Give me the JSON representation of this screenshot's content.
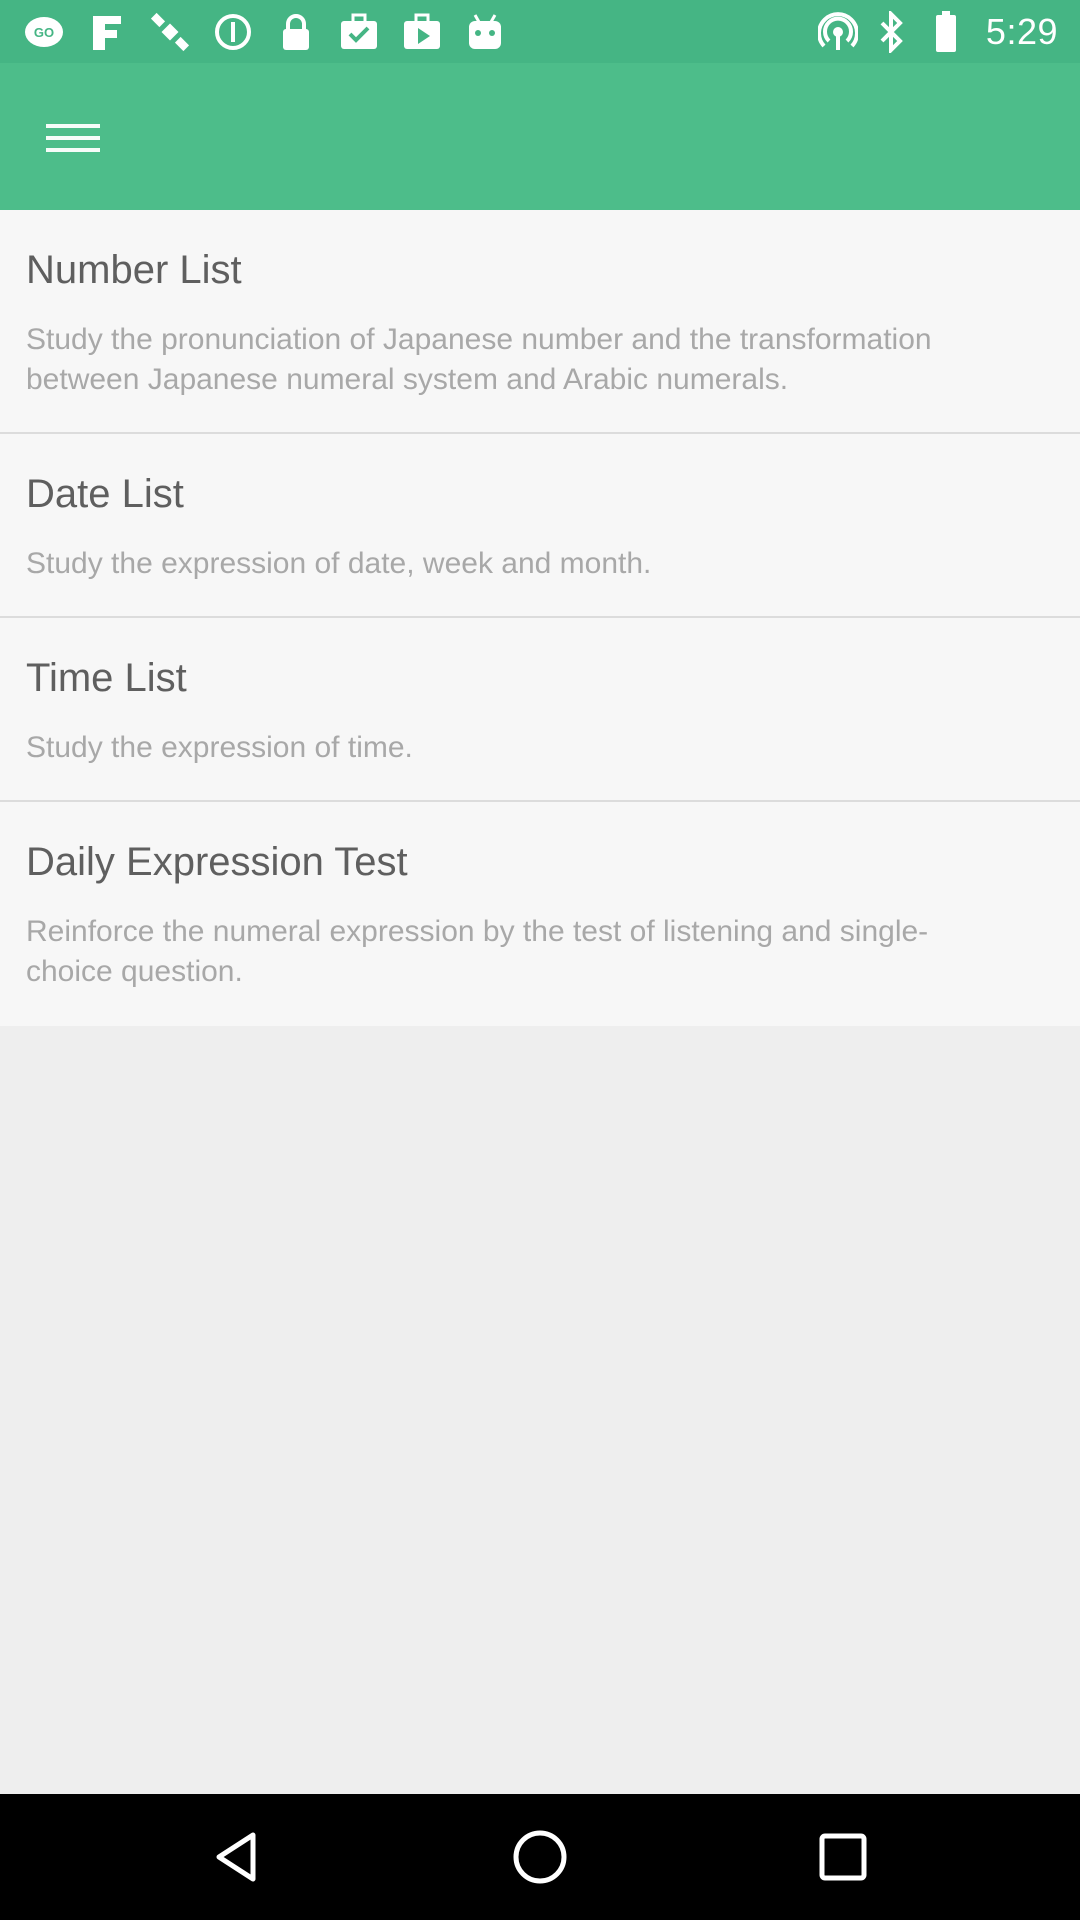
{
  "status_bar": {
    "time": "5:29",
    "left_icons": [
      "go-icon",
      "fake-icon",
      "satellite-icon",
      "alert-icon",
      "lock-icon",
      "briefcase-check-icon",
      "play-store-icon",
      "android-icon"
    ],
    "right_icons": [
      "hotspot-icon",
      "bluetooth-icon",
      "battery-icon"
    ]
  },
  "app_bar": {
    "menu_icon": "hamburger-menu-icon",
    "color": "#4dbd8a"
  },
  "items": [
    {
      "title": "Number List",
      "description": "Study the pronunciation of Japanese number and the transformation between Japanese numeral system and Arabic numerals."
    },
    {
      "title": "Date List",
      "description": "Study the expression of date, week and month."
    },
    {
      "title": "Time List",
      "description": "Study the expression of time."
    },
    {
      "title": "Daily Expression Test",
      "description": "Reinforce the numeral expression by the test of listening and single-choice question."
    }
  ],
  "nav_bar": {
    "icons": [
      "back-icon",
      "home-icon",
      "recents-icon"
    ]
  }
}
